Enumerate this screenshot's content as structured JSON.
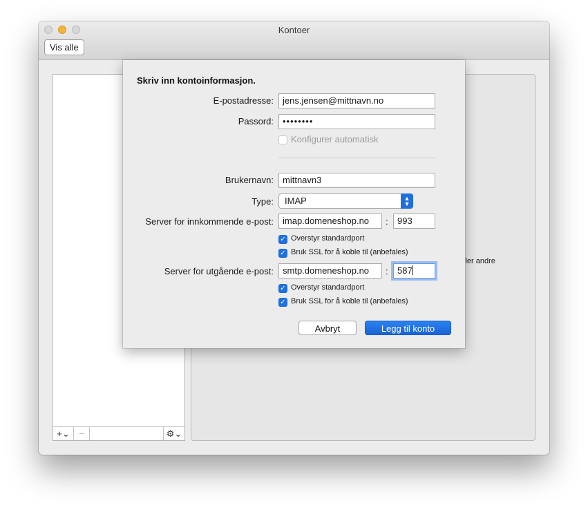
{
  "window": {
    "title": "Kontoer",
    "show_all_label": "Vis alle"
  },
  "accounts_list": {
    "add_label": "+⌄",
    "remove_label": "−",
    "gear_label": "⚙⌄"
  },
  "detail_pane": {
    "partial_text": "ller andre"
  },
  "sheet": {
    "heading": "Skriv inn kontoinformasjon.",
    "email_label": "E-postadresse:",
    "email_value": "jens.jensen@mittnavn.no",
    "password_label": "Passord:",
    "password_value": "••••••••",
    "auto_config_label": "Konfigurer automatisk",
    "username_label": "Brukernavn:",
    "username_value": "mittnavn3",
    "type_label": "Type:",
    "type_value": "IMAP",
    "incoming_label": "Server for innkommende e-post:",
    "incoming_server": "imap.domeneshop.no",
    "incoming_port": "993",
    "incoming_override_label": "Overstyr standardport",
    "incoming_ssl_label": "Bruk SSL for å koble til (anbefales)",
    "outgoing_label": "Server for utgående e-post:",
    "outgoing_server": "smtp.domeneshop.no",
    "outgoing_port": "587",
    "outgoing_override_label": "Overstyr standardport",
    "outgoing_ssl_label": "Bruk SSL for å koble til (anbefales)",
    "port_separator": ":",
    "cancel_label": "Avbryt",
    "add_account_label": "Legg til konto"
  },
  "colors": {
    "accent": "#1f6fdc",
    "focus_ring": "#5e96e8"
  }
}
